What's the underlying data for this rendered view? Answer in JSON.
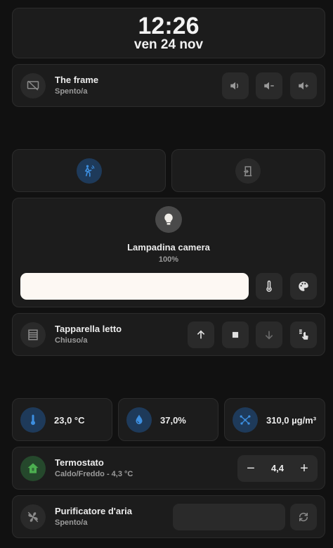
{
  "clock": {
    "time": "12:26",
    "date": "ven 24 nov"
  },
  "media": {
    "name": "The frame",
    "state": "Spento/a",
    "icon": "tv-off-icon"
  },
  "presence": {
    "left_icon": "motion-sensor-icon",
    "right_icon": "door-open-icon"
  },
  "light": {
    "name": "Lampadina camera",
    "state": "100%",
    "brightness": 1.0,
    "slider_color": "#fdf8f3",
    "icon": "lightbulb-icon"
  },
  "cover": {
    "name": "Tapparella letto",
    "state": "Chiuso/a",
    "icon": "blinds-icon"
  },
  "sensors": [
    {
      "value": "23,0 °C",
      "icon": "thermometer-icon"
    },
    {
      "value": "37,0%",
      "icon": "water-drop-icon"
    },
    {
      "value": "310,0 µg/m³",
      "icon": "molecule-icon"
    }
  ],
  "thermostat": {
    "name": "Termostato",
    "state": "Caldo/Freddo - 4,3 °C",
    "setpoint": "4,4",
    "minus": "−",
    "plus": "+",
    "icon": "home-thermostat-icon"
  },
  "purifier": {
    "name": "Purificatore d'aria",
    "state": "Spento/a",
    "icon": "fan-off-icon"
  },
  "colors": {
    "background": "#111111",
    "card": "#1c1c1c",
    "accent_blue": "#1e3a5a",
    "icon_blue": "#3d8fe0",
    "accent_green": "#25482c",
    "icon_green": "#4caf50"
  }
}
